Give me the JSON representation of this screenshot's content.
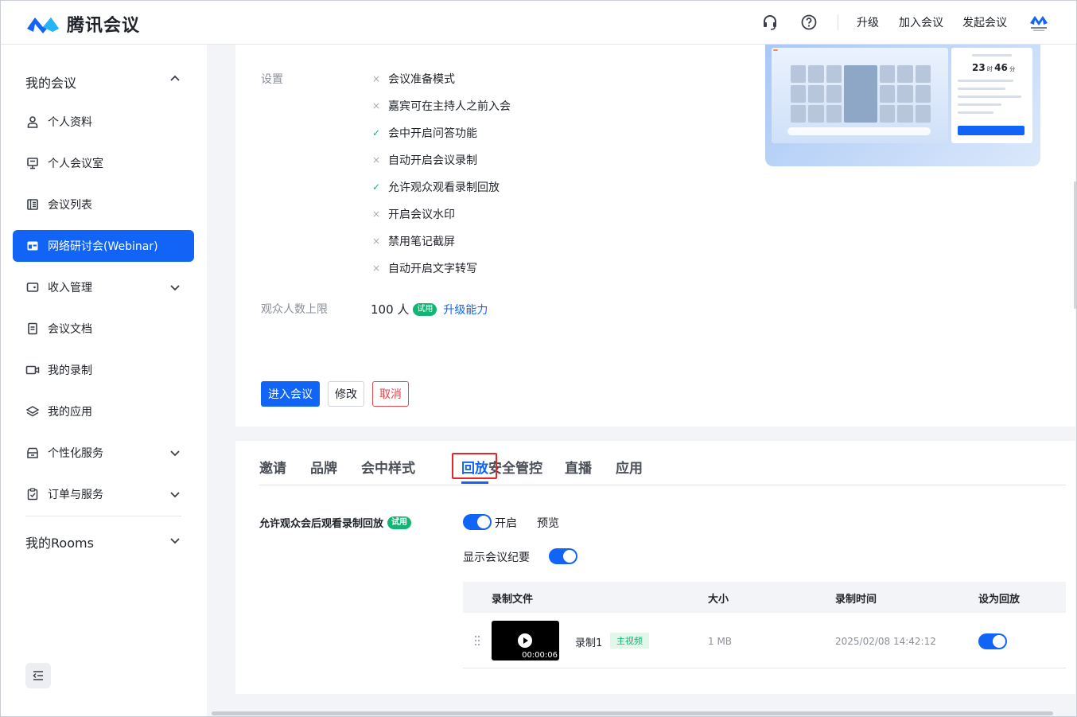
{
  "header": {
    "app_name": "腾讯会议",
    "upgrade": "升级",
    "join": "加入会议",
    "start": "发起会议",
    "icons": [
      "headset-icon",
      "help-icon"
    ],
    "brand_color": "#1164f5"
  },
  "sidebar": {
    "my_meetings": "我的会议",
    "items": [
      {
        "label": "个人资料",
        "icon": "user-icon"
      },
      {
        "label": "个人会议室",
        "icon": "monitor-icon"
      },
      {
        "label": "会议列表",
        "icon": "list-icon"
      },
      {
        "label": "网络研讨会(Webinar)",
        "icon": "webinar-icon",
        "active": true
      },
      {
        "label": "收入管理",
        "icon": "wallet-icon",
        "expandable": true
      },
      {
        "label": "会议文档",
        "icon": "document-icon"
      },
      {
        "label": "我的录制",
        "icon": "video-icon"
      },
      {
        "label": "我的应用",
        "icon": "layers-icon"
      },
      {
        "label": "个性化服务",
        "icon": "store-icon",
        "expandable": true
      },
      {
        "label": "订单与服务",
        "icon": "clipboard-icon",
        "expandable": true
      }
    ],
    "my_rooms": "我的Rooms"
  },
  "settings": {
    "label": "设置",
    "items": [
      {
        "text": "会议准备模式",
        "on": false,
        "mark": "×"
      },
      {
        "text": "嘉宾可在主持人之前入会",
        "on": false,
        "mark": "×"
      },
      {
        "text": "会中开启问答功能",
        "on": true,
        "mark": "✓"
      },
      {
        "text": "自动开启会议录制",
        "on": false,
        "mark": "×"
      },
      {
        "text": "允许观众观看录制回放",
        "on": true,
        "mark": "✓"
      },
      {
        "text": "开启会议水印",
        "on": false,
        "mark": "×"
      },
      {
        "text": "禁用笔记截屏",
        "on": false,
        "mark": "×"
      },
      {
        "text": "自动开启文字转写",
        "on": false,
        "mark": "×"
      }
    ],
    "audience_limit_label": "观众人数上限",
    "audience_limit_value": "100 人",
    "trial_badge": "试用",
    "upgrade_link": "升级能力"
  },
  "preview": {
    "hours": "23",
    "minutes": "46"
  },
  "actions": {
    "enter": "进入会议",
    "edit": "修改",
    "cancel": "取消"
  },
  "tabs": [
    "邀请",
    "品牌",
    "会中样式",
    "回放",
    "安全管控",
    "直播",
    "应用"
  ],
  "active_tab": "回放",
  "playback": {
    "title": "允许观众会后观看录制回放",
    "trial_badge": "试用",
    "toggle_label": "开启",
    "preview_link": "预览",
    "show_summary": "显示会议纪要",
    "columns": [
      "录制文件",
      "大小",
      "录制时间",
      "设为回放"
    ],
    "rows": [
      {
        "name": "录制1",
        "tag": "主视频",
        "duration": "00:00:06",
        "size": "1 MB",
        "time": "2025/02/08 14:42:12",
        "set_playback": true
      }
    ]
  }
}
